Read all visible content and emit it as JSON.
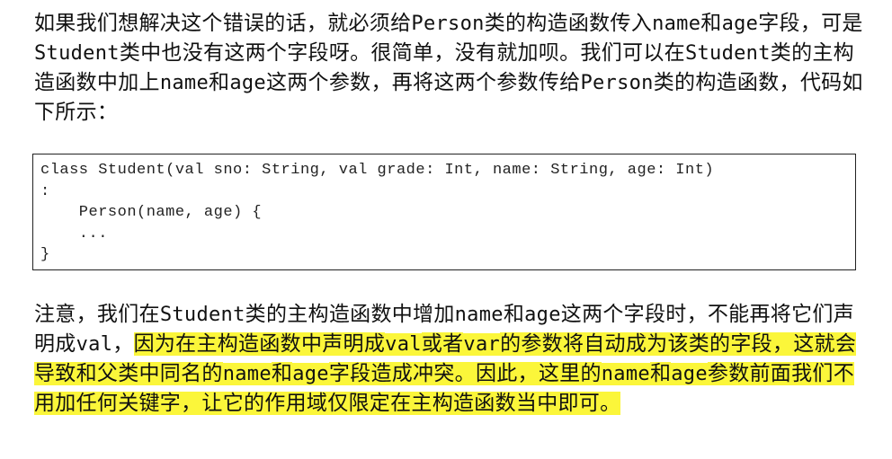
{
  "para1": {
    "s1": "如果我们想解决这个错误的话，就必须给",
    "c1": "Person",
    "s2": "类的构造函数传入",
    "c2": "name",
    "s3": "和",
    "c3": "age",
    "s4": "字段，可是",
    "c4": "Student",
    "s5": "类中也没有这两个字段呀。很简单，没有就加呗。我们可以在",
    "c5": "Student",
    "s6": "类的主构造函数中加上",
    "c6": "name",
    "s7": "和",
    "c7": "age",
    "s8": "这两个参数，再将这两个参数传给",
    "c8": "Person",
    "s9": "类的构造函数，代码如下所示："
  },
  "code": {
    "line1": "class Student(val sno: String, val grade: Int, name: String, age: Int)",
    "line2": ":",
    "line3": "    Person(name, age) {",
    "line4": "    ...",
    "line5": "}"
  },
  "para2": {
    "s1": "注意，我们在",
    "c1": "Student",
    "s2": "类的主构造函数中增加",
    "c2": "name",
    "s3": "和",
    "c3": "age",
    "s4": "这两个字段时，不能再将它们声明成",
    "c4": "val",
    "s5": "，",
    "h1": "因为在主构造函数中声明成",
    "hc1": "val",
    "h2": "或者",
    "hc2": "var",
    "h3": "的参数将自动成为该类的字段，这就会导致和父类中同名的",
    "hc3": "name",
    "h4": "和",
    "hc4": "age",
    "h5": "字段造成冲突。因此，这里的",
    "hc5": "name",
    "h6": "和",
    "hc6": "age",
    "h7": "参数前面我们不用加任何关键字，让它的作用域仅限定在主构造函数当中即可。"
  },
  "colors": {
    "highlight": "#fbf63a",
    "text": "#111111",
    "border": "#222222"
  }
}
